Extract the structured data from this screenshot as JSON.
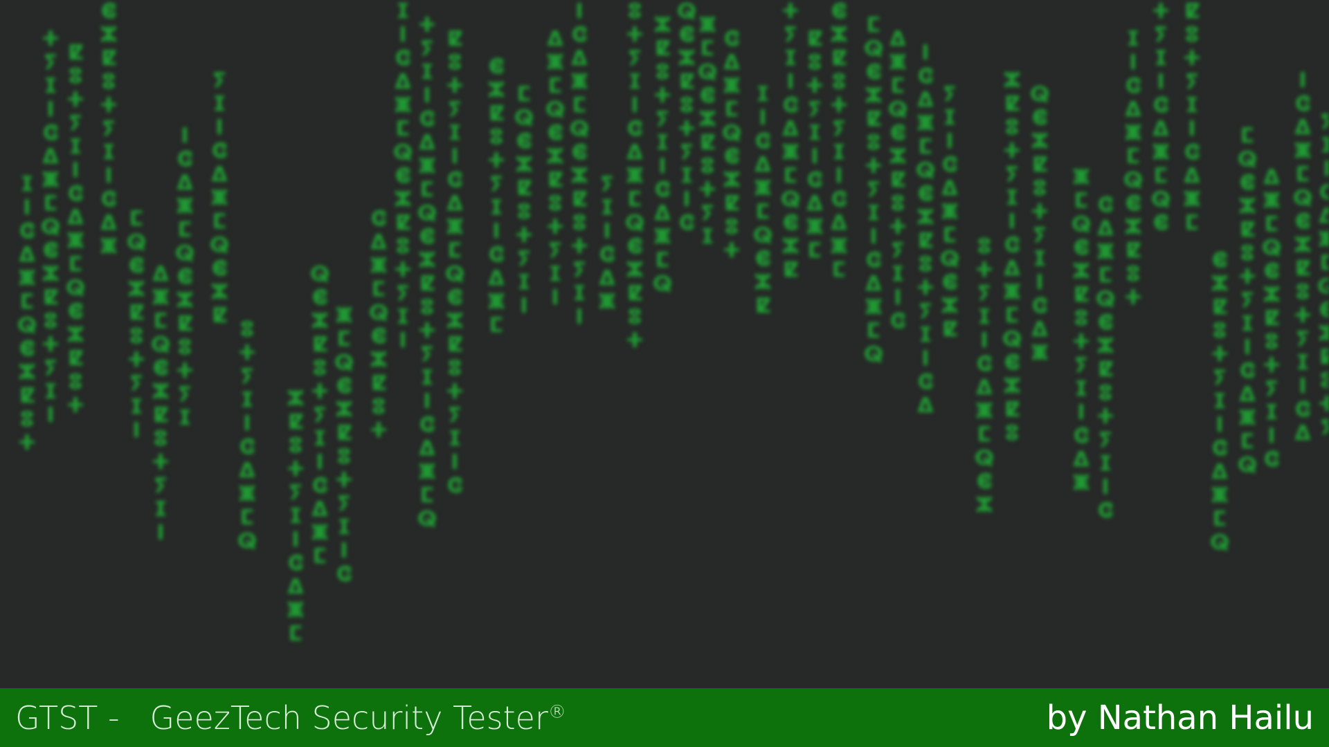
{
  "background": {
    "color": "#262927",
    "rain_color": "#1fb437",
    "rain_glyphs": "ⵊⵇⵎⵏⵓⵕⵛⵜⵞⵠⵢⵣⵥ"
  },
  "footer": {
    "color": "#0d720c",
    "product_code": "GTST -",
    "product_name": "GeezTech Security Tester",
    "trademark": "®",
    "author_credit": "by Nathan Hailu"
  }
}
